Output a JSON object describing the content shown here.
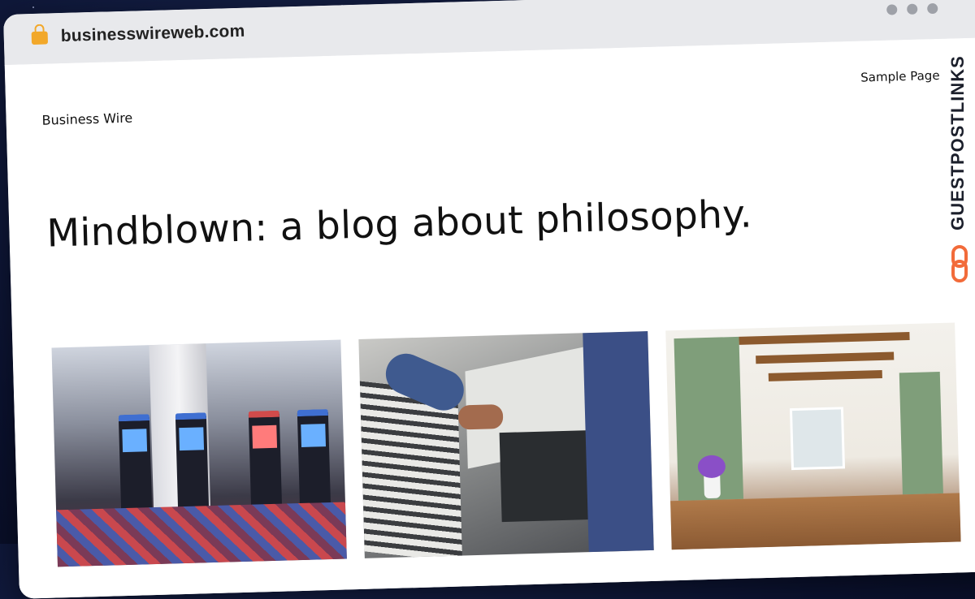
{
  "browser": {
    "url": "businesswireweb.com"
  },
  "site": {
    "title": "Business Wire",
    "nav": [
      "Sample Page"
    ],
    "hero_title": "Mindblown: a blog about philosophy."
  },
  "cards": [
    {
      "image": "casino-slot-machines"
    },
    {
      "image": "hvac-technician-repair"
    },
    {
      "image": "green-kitchen-interior"
    }
  ],
  "watermark": {
    "text": "GUESTPOSTLINKS",
    "accent": "#f26b3a"
  },
  "colors": {
    "lock": "#f2a82a",
    "chrome": "#e8e9ec",
    "page_bg": "#ffffff",
    "text": "#111111"
  }
}
